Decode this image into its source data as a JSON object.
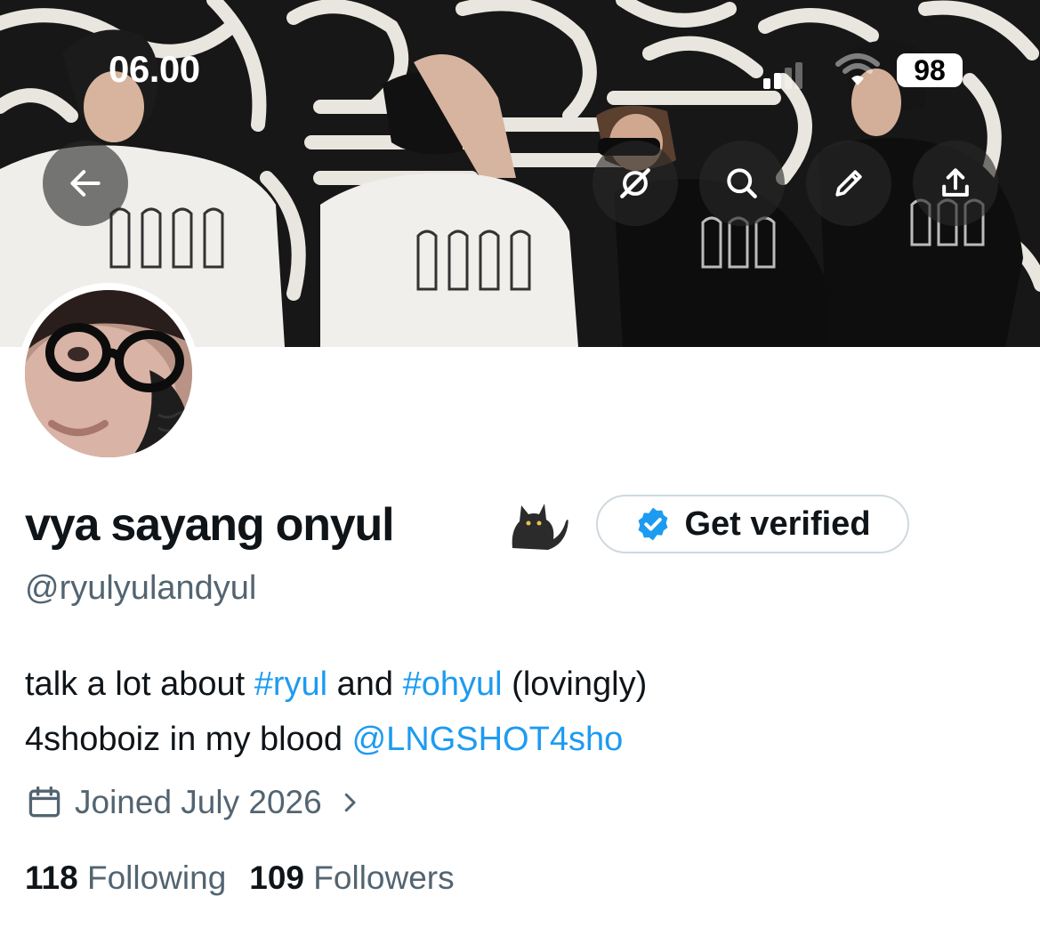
{
  "status_bar": {
    "time": "06.00",
    "battery": "98"
  },
  "header_buttons": [
    "back-button",
    "grok-button",
    "search-button",
    "edit-button",
    "share-button"
  ],
  "profile": {
    "display_name": "vya sayang onyul",
    "name_emoji": "cat-emoji",
    "verify_label": "Get verified",
    "handle": "@ryulyulandyul",
    "bio": {
      "line1_before": "talk a lot about ",
      "tag1": "#ryul",
      "line1_mid": " and ",
      "tag2": "#ohyul",
      "line1_after": " (lovingly)",
      "line2_before": "4shoboiz in my blood ",
      "mention": "@LNGSHOT4sho"
    },
    "joined": "Joined July 2026",
    "following_count": "118",
    "following_label": "Following",
    "followers_count": "109",
    "followers_label": "Followers"
  },
  "colors": {
    "accent": "#1d9bf0",
    "text": "#0f1419",
    "secondary": "#536471",
    "border": "#cfd9de"
  }
}
